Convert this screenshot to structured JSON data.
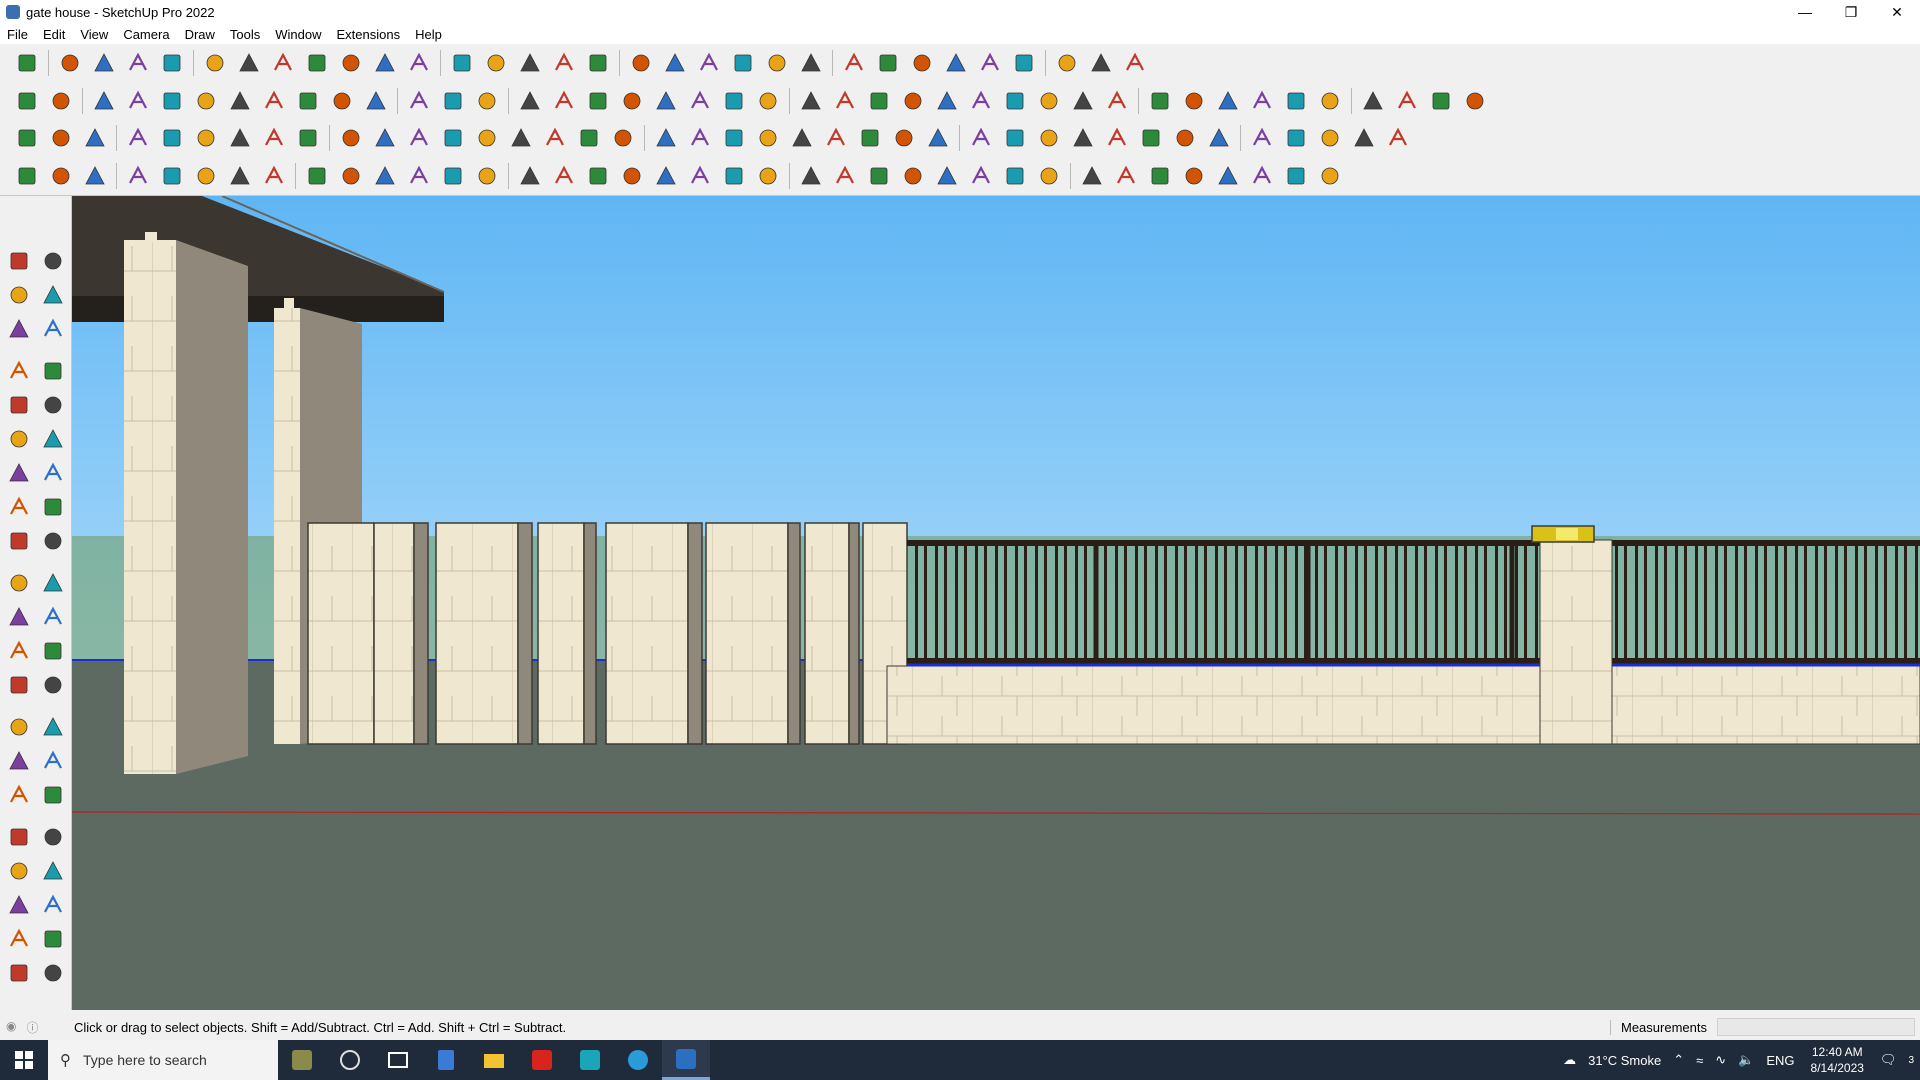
{
  "window": {
    "title": "gate house - SketchUp Pro 2022",
    "controls": [
      "minimize",
      "maximize",
      "close"
    ]
  },
  "menu": [
    "File",
    "Edit",
    "View",
    "Camera",
    "Draw",
    "Tools",
    "Window",
    "Extensions",
    "Help"
  ],
  "status": {
    "hint": "Click or drag to select objects. Shift = Add/Subtract. Ctrl = Add. Shift + Ctrl = Subtract.",
    "measurements_label": "Measurements",
    "measurements_value": ""
  },
  "taskbar": {
    "search_placeholder": "Type here to search",
    "weather": "31°C  Smoke",
    "language": "ENG",
    "time": "12:40 AM",
    "date": "8/14/2023",
    "notification_count": "3"
  },
  "colors": {
    "sky_top": "#5fb6f4",
    "sky_bottom": "#a7d8fa",
    "ground": "#5d6a62",
    "stone": "#efe7cf",
    "railing": "#2a1e16"
  }
}
